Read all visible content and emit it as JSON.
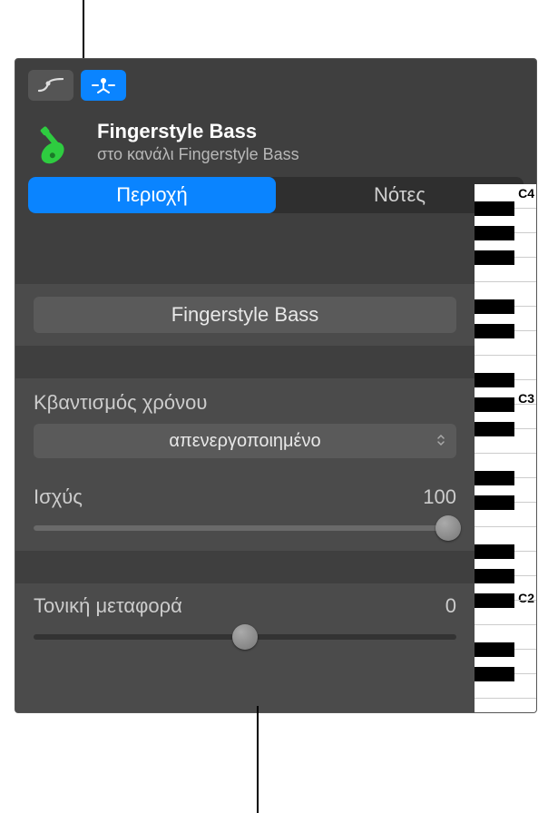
{
  "toolbar": {
    "automation_icon": "automation-curve-icon",
    "flex_icon": "flex-tuning-icon"
  },
  "track": {
    "title": "Fingerstyle Bass",
    "subtitle": "στο κανάλι Fingerstyle Bass",
    "icon": "bass-guitar-icon",
    "icon_color": "#2ecc40"
  },
  "tabs": {
    "region": "Περιοχή",
    "notes": "Νότες"
  },
  "region": {
    "name": "Fingerstyle Bass"
  },
  "quantize": {
    "label": "Κβαντισμός χρόνου",
    "value": "απενεργοποιημένο"
  },
  "strength": {
    "label": "Ισχύς",
    "value": "100",
    "percent": 100
  },
  "transpose": {
    "label": "Τονική μεταφορά",
    "value": "0",
    "percent": 50
  },
  "piano": {
    "labels": [
      "C4",
      "C3",
      "C2"
    ]
  }
}
